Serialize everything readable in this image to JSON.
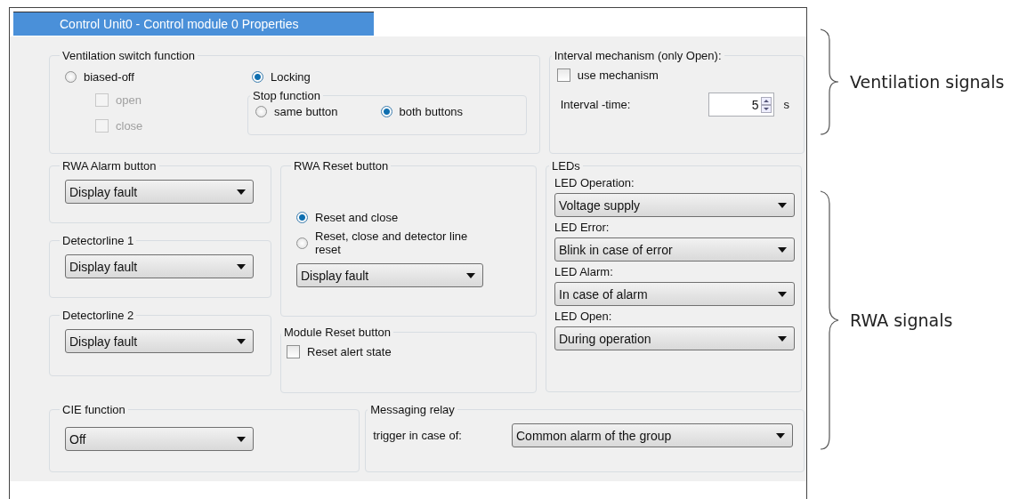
{
  "window": {
    "title": "Control Unit0 - Control module 0 Properties"
  },
  "ventilation_switch": {
    "title": "Ventilation switch function",
    "options": [
      {
        "label": "biased-off",
        "selected": false
      },
      {
        "label": "Locking",
        "selected": true
      }
    ],
    "sub_options": [
      {
        "label": "open",
        "checked": false,
        "disabled": true
      },
      {
        "label": "close",
        "checked": false,
        "disabled": true
      }
    ],
    "stop_function": {
      "title": "Stop function",
      "options": [
        {
          "label": "same button",
          "selected": false
        },
        {
          "label": "both buttons",
          "selected": true
        }
      ]
    }
  },
  "interval": {
    "title": "Interval mechanism (only Open):",
    "checkbox": {
      "label": "use mechanism",
      "checked": false
    },
    "time_label": "Interval -time:",
    "time_value": "5",
    "unit": "s"
  },
  "rwa_alarm": {
    "title": "RWA Alarm button",
    "value": "Display fault"
  },
  "detectorline_1": {
    "title": "Detectorline 1",
    "value": "Display fault"
  },
  "detectorline_2": {
    "title": "Detectorline 2",
    "value": "Display fault"
  },
  "rwa_reset": {
    "title": "RWA Reset button",
    "options": [
      {
        "label": "Reset and close",
        "selected": true
      },
      {
        "label": "Reset, close and detector line reset",
        "selected": false
      }
    ],
    "value": "Display fault"
  },
  "module_reset": {
    "title": "Module Reset button",
    "checkbox": {
      "label": "Reset alert state",
      "checked": false
    }
  },
  "leds": {
    "title": "LEDs",
    "items": [
      {
        "label": "LED Operation:",
        "value": "Voltage supply"
      },
      {
        "label": "LED Error:",
        "value": "Blink in case of error"
      },
      {
        "label": "LED Alarm:",
        "value": "In case of alarm"
      },
      {
        "label": "LED Open:",
        "value": "During operation"
      }
    ]
  },
  "cie": {
    "title": "CIE function",
    "value": "Off"
  },
  "messaging_relay": {
    "title": "Messaging relay",
    "trigger_label": "trigger in case of:",
    "value": "Common alarm of the group"
  },
  "annotations": [
    {
      "label": "Ventilation signals"
    },
    {
      "label": "RWA signals"
    }
  ]
}
